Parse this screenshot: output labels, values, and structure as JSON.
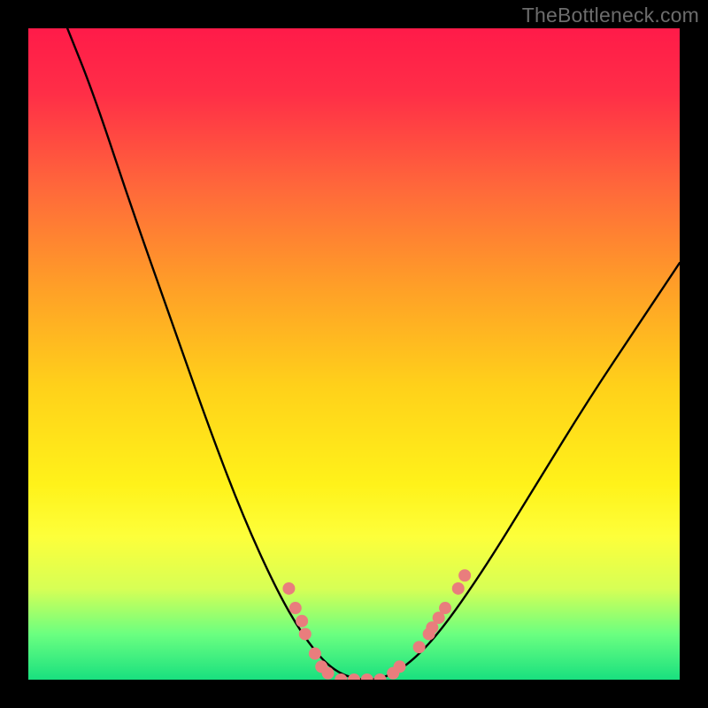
{
  "watermark": "TheBottleneck.com",
  "colors": {
    "gradient_stops": [
      {
        "offset": 0.0,
        "color": "#ff1b49"
      },
      {
        "offset": 0.1,
        "color": "#ff2e47"
      },
      {
        "offset": 0.25,
        "color": "#ff6a3a"
      },
      {
        "offset": 0.4,
        "color": "#ffa027"
      },
      {
        "offset": 0.55,
        "color": "#ffd11a"
      },
      {
        "offset": 0.7,
        "color": "#fff21a"
      },
      {
        "offset": 0.78,
        "color": "#fdff3a"
      },
      {
        "offset": 0.86,
        "color": "#d7ff55"
      },
      {
        "offset": 0.93,
        "color": "#6bff80"
      },
      {
        "offset": 1.0,
        "color": "#19e07f"
      }
    ],
    "curve_stroke": "#000000",
    "dot_fill": "#e97d7d",
    "background": "#000000"
  },
  "chart_data": {
    "type": "line",
    "title": "",
    "xlabel": "",
    "ylabel": "",
    "xlim": [
      0,
      100
    ],
    "ylim": [
      0,
      100
    ],
    "curve": [
      {
        "x": 6,
        "y": 100
      },
      {
        "x": 10,
        "y": 90
      },
      {
        "x": 16,
        "y": 72
      },
      {
        "x": 22,
        "y": 55
      },
      {
        "x": 28,
        "y": 38
      },
      {
        "x": 33,
        "y": 25
      },
      {
        "x": 38,
        "y": 14
      },
      {
        "x": 42,
        "y": 7
      },
      {
        "x": 46,
        "y": 2
      },
      {
        "x": 50,
        "y": 0
      },
      {
        "x": 54,
        "y": 0
      },
      {
        "x": 58,
        "y": 2
      },
      {
        "x": 63,
        "y": 7
      },
      {
        "x": 70,
        "y": 17
      },
      {
        "x": 78,
        "y": 30
      },
      {
        "x": 86,
        "y": 43
      },
      {
        "x": 94,
        "y": 55
      },
      {
        "x": 100,
        "y": 64
      }
    ],
    "dots": [
      {
        "x": 40,
        "y": 14
      },
      {
        "x": 41,
        "y": 11
      },
      {
        "x": 42,
        "y": 9
      },
      {
        "x": 42.5,
        "y": 7
      },
      {
        "x": 44,
        "y": 4
      },
      {
        "x": 45,
        "y": 2
      },
      {
        "x": 46,
        "y": 1
      },
      {
        "x": 48,
        "y": 0
      },
      {
        "x": 50,
        "y": 0
      },
      {
        "x": 52,
        "y": 0
      },
      {
        "x": 54,
        "y": 0
      },
      {
        "x": 56,
        "y": 1
      },
      {
        "x": 57,
        "y": 2
      },
      {
        "x": 60,
        "y": 5
      },
      {
        "x": 61.5,
        "y": 7
      },
      {
        "x": 62,
        "y": 8
      },
      {
        "x": 63,
        "y": 9.5
      },
      {
        "x": 64,
        "y": 11
      },
      {
        "x": 66,
        "y": 14
      },
      {
        "x": 67,
        "y": 16
      }
    ]
  }
}
